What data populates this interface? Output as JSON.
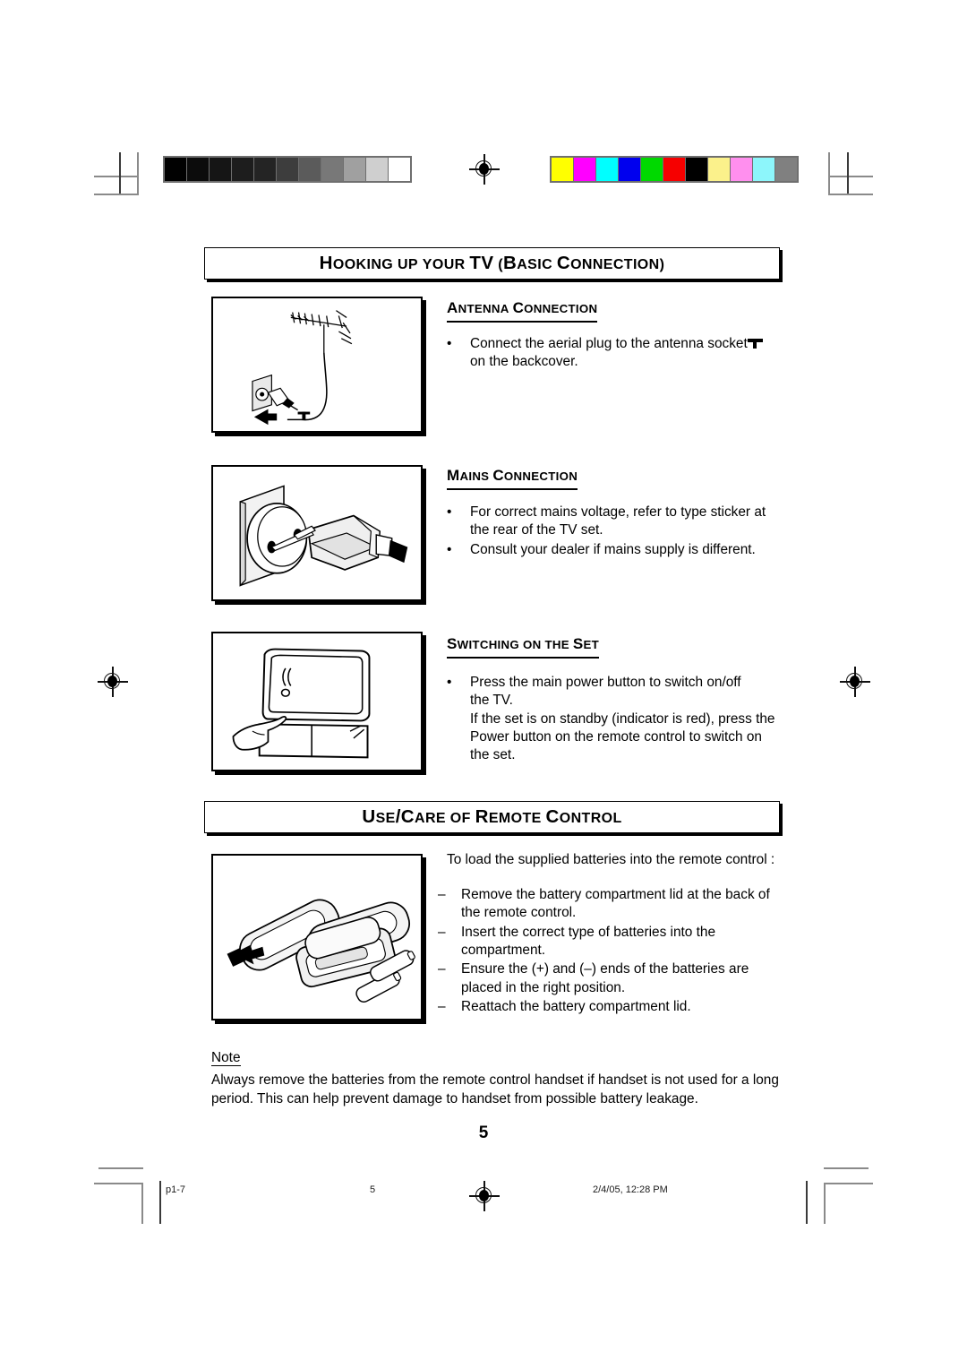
{
  "document": {
    "page_number": "5",
    "sections": [
      {
        "banner_title": "Hooking up your TV (Basic Connection)",
        "subsections": [
          {
            "heading": "Antenna Connection",
            "figure_name": "antenna-connection-illustration",
            "items": [
              {
                "marker": "•",
                "text": "Connect the aerial plug to the antenna socket",
                "has_antenna_symbol": true,
                "continuation": "on the backcover."
              }
            ]
          },
          {
            "heading": "Mains Connection",
            "figure_name": "mains-connection-illustration",
            "items": [
              {
                "marker": "•",
                "text": "For correct mains voltage, refer to type sticker at",
                "continuation": "the rear of the TV set."
              },
              {
                "marker": "•",
                "text": "Consult your dealer if mains supply is different."
              }
            ]
          },
          {
            "heading": "Switching on the Set",
            "figure_name": "switching-on-the-set-illustration",
            "items": [
              {
                "marker": "•",
                "text": "Press the main power button to switch on/off",
                "continuation": "the TV.",
                "extra_lines": [
                  "If the set is on standby (indicator is red), press the",
                  "Power button on the remote control to switch on",
                  "the set."
                ]
              }
            ]
          }
        ]
      },
      {
        "banner_title": "Use/Care of Remote Control",
        "figure_name": "remote-control-battery-illustration",
        "intro": "To load the supplied batteries into the remote control :",
        "items": [
          {
            "marker": "–",
            "text": "Remove the battery compartment lid at the back of",
            "continuation": "the remote control."
          },
          {
            "marker": "–",
            "text": "Insert the correct type of batteries into the",
            "continuation": "compartment."
          },
          {
            "marker": "–",
            "text": "Ensure the (+) and (–) ends of the batteries are",
            "continuation": "placed in the right position."
          },
          {
            "marker": "–",
            "text": "Reattach the battery compartment lid."
          }
        ],
        "note": {
          "label": "Note",
          "lines": [
            "Always remove the batteries from the remote control handset if handset is not used for a long",
            "period. This can help prevent damage to handset from possible battery leakage."
          ]
        }
      }
    ]
  },
  "print_marks": {
    "grayscale_bar": {
      "name": "grayscale-calibration-bar",
      "swatches": [
        "#010101",
        "#0c0c0c",
        "#151515",
        "#1d1d1d",
        "#242424",
        "#3d3d3d",
        "#5b5b5b",
        "#787878",
        "#a0a0a0",
        "#cfcfcf",
        "#ffffff"
      ]
    },
    "color_bar": {
      "name": "color-calibration-bar",
      "swatches": [
        "#ffff00",
        "#ff00ff",
        "#00ffff",
        "#0000ee",
        "#00d900",
        "#f60000",
        "#000000",
        "#fbf18b",
        "#ff8fee",
        "#8df6fb",
        "#808080"
      ]
    },
    "registration_targets": [
      "top-center",
      "left-middle",
      "right-middle",
      "bottom-center"
    ]
  },
  "footer": {
    "file_label": "p1-7",
    "page_label": "5",
    "timestamp": "2/4/05, 12:28 PM"
  }
}
